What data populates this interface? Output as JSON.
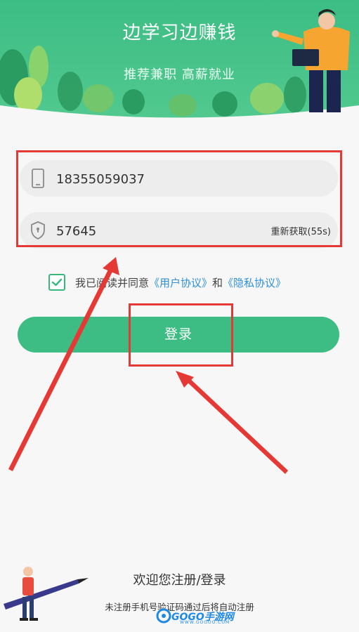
{
  "header": {
    "title": "边学习边赚钱",
    "subtitle": "推荐兼职 高薪就业"
  },
  "form": {
    "phone": {
      "value": "18355059037",
      "icon": "phone-icon"
    },
    "code": {
      "value": "57645",
      "icon": "shield-lock-icon",
      "resend_label": "重新获取(55s)"
    }
  },
  "agreement": {
    "checked": true,
    "prefix": "我已阅读并同意",
    "user_agreement": "《用户协议》",
    "and": "和",
    "privacy_policy": "《隐私协议》"
  },
  "login_button": {
    "label": "登录"
  },
  "footer": {
    "welcome": "欢迎您注册/登录",
    "notice": "未注册手机号验证码通过后将自动注册"
  },
  "watermark": {
    "text": "GOGO手游网",
    "sub": "WWW.GOGOO.COM"
  },
  "colors": {
    "primary_green": "#3dbd84",
    "link_blue": "#2f8fd9",
    "annotation_red": "#e53935"
  }
}
